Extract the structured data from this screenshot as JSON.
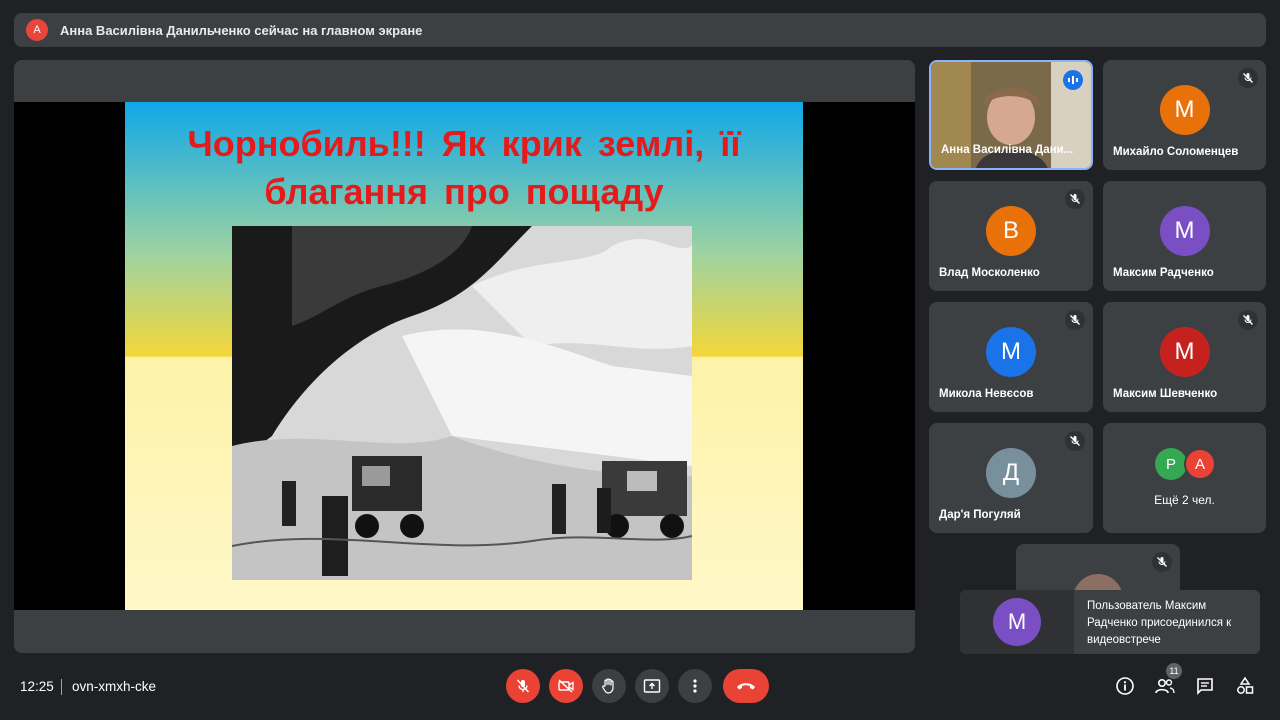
{
  "topbar": {
    "avatar_letter": "А",
    "presenter_text": "Анна Василівна Данильченко сейчас на главном экране"
  },
  "slide": {
    "title_line1": "Чорнобиль!!! Як крик землі, її",
    "title_line2": "благання про пощаду"
  },
  "participants": [
    {
      "name": "Анна Василівна Дани...",
      "speaking": true
    },
    {
      "name": "Михайло Соломенцев",
      "letter": "М",
      "color": "#e8710a"
    },
    {
      "name": "Влад Москоленко",
      "letter": "В",
      "color": "#e8710a"
    },
    {
      "name": "Максим Радченко",
      "letter": "М",
      "color": "#7b4fc4"
    },
    {
      "name": "Микола Невєсов",
      "letter": "М",
      "color": "#1a73e8"
    },
    {
      "name": "Максим Шевченко",
      "letter": "М",
      "color": "#c5221f"
    },
    {
      "name": "Дар'я Погуляй",
      "letter": "Д",
      "color": "#78909c"
    },
    {
      "name": "Ещё 2 чел.",
      "letters": [
        "Р",
        "А"
      ],
      "colors": [
        "#34a853",
        "#ea4335"
      ]
    }
  ],
  "toast": {
    "letter": "М",
    "message": "Пользователь Максим Радченко присоединился к видеовстрече"
  },
  "bottombar": {
    "time": "12:25",
    "meeting_code": "ovn-xmxh-cke",
    "participants_count": "11"
  }
}
